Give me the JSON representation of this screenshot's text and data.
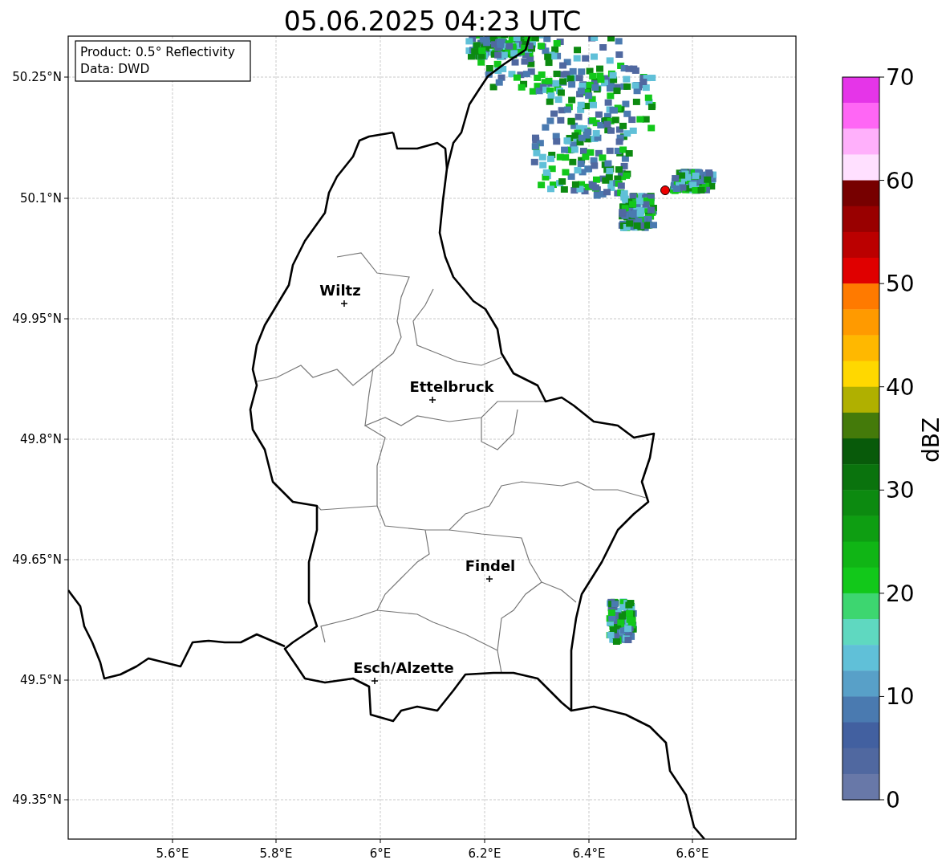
{
  "title": "05.06.2025 04:23 UTC",
  "info_box": [
    "Product: 0.5° Reflectivity",
    "Data: DWD"
  ],
  "lat_labels": [
    "50.25°N",
    "50.1°N",
    "49.95°N",
    "49.8°N",
    "49.65°N",
    "49.5°N",
    "49.35°N"
  ],
  "lon_labels": [
    "5.6°E",
    "5.8°E",
    "6°E",
    "6.2°E",
    "6.4°E",
    "6.6°E"
  ],
  "cities": [
    {
      "name": "Wiltz"
    },
    {
      "name": "Ettelbruck"
    },
    {
      "name": "Findel"
    },
    {
      "name": "Esch/Alzette"
    }
  ],
  "colorbar": {
    "label": "dBZ",
    "ticks": [
      "70",
      "60",
      "50",
      "40",
      "30",
      "20",
      "10",
      "0"
    ],
    "bins": [
      {
        "color": "#e535e8"
      },
      {
        "color": "#ff66f5"
      },
      {
        "color": "#ffb0fb"
      },
      {
        "color": "#ffe0ff"
      },
      {
        "color": "#770000"
      },
      {
        "color": "#990000"
      },
      {
        "color": "#bb0000"
      },
      {
        "color": "#e00000"
      },
      {
        "color": "#ff7a00"
      },
      {
        "color": "#ff9a00"
      },
      {
        "color": "#ffb800"
      },
      {
        "color": "#ffd800"
      },
      {
        "color": "#b0b000"
      },
      {
        "color": "#447a0a"
      },
      {
        "color": "#085a0a"
      },
      {
        "color": "#0a730d"
      },
      {
        "color": "#0c8a10"
      },
      {
        "color": "#0e9e12"
      },
      {
        "color": "#10b515"
      },
      {
        "color": "#12c81a"
      },
      {
        "color": "#3dd670"
      },
      {
        "color": "#5fd8c0"
      },
      {
        "color": "#60c0d8"
      },
      {
        "color": "#58a0c8"
      },
      {
        "color": "#4a7ab0"
      },
      {
        "color": "#4260a0"
      },
      {
        "color": "#5068a0"
      },
      {
        "color": "#6878a8"
      }
    ]
  }
}
